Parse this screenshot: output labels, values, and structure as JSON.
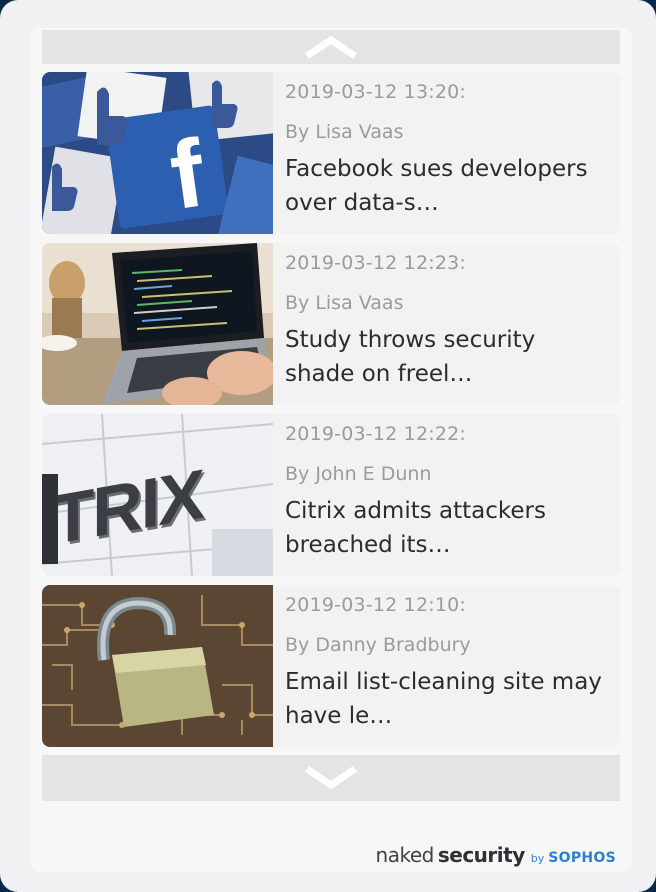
{
  "nav": {
    "up_icon": "chevron-up-icon",
    "down_icon": "chevron-down-icon"
  },
  "articles": [
    {
      "date": "2019-03-12 13:20:",
      "author": "By Lisa Vaas",
      "title": "Facebook sues developers over data-s…",
      "thumb_icon": "facebook-thumbs-down-image"
    },
    {
      "date": "2019-03-12 12:23:",
      "author": "By Lisa Vaas",
      "title": "Study throws security shade on freel…",
      "thumb_icon": "laptop-coding-image"
    },
    {
      "date": "2019-03-12 12:22:",
      "author": "By John E Dunn",
      "title": "Citrix admits attackers breached its…",
      "thumb_icon": "citrix-sign-image"
    },
    {
      "date": "2019-03-12 12:10:",
      "author": "By Danny Bradbury",
      "title": "Email list-cleaning site may have le…",
      "thumb_icon": "open-padlock-circuit-image"
    }
  ],
  "footer": {
    "logo_naked": "naked",
    "logo_security": "security",
    "logo_by": "by",
    "logo_sophos": "SOPHOS"
  },
  "colors": {
    "background": "#f0f1f3",
    "nav_bar": "#e3e4e6",
    "muted_text": "#9a9b9d",
    "title_text": "#2c2c2e",
    "sophos_blue": "#2c7fd6"
  }
}
